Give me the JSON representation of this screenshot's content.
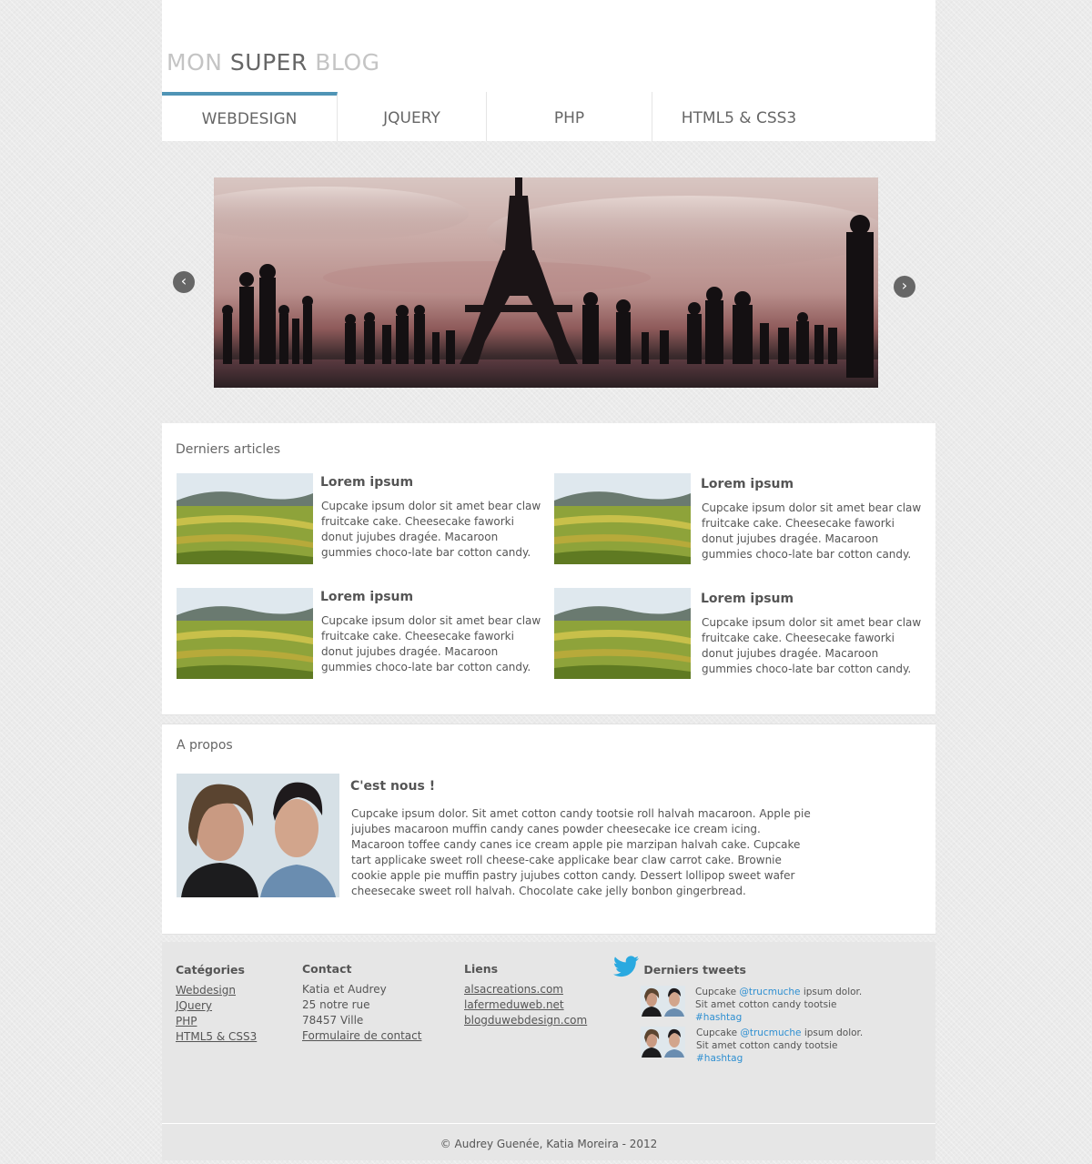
{
  "logo": {
    "part1": "MON",
    "part2": "SUPER",
    "part3": "BLOG"
  },
  "nav": [
    {
      "label": "WEBDESIGN"
    },
    {
      "label": "JQUERY"
    },
    {
      "label": "PHP"
    },
    {
      "label": "HTML5 & CSS3"
    }
  ],
  "slider": {
    "prev_label": "‹",
    "next_label": "›"
  },
  "articles": {
    "title": "Derniers articles",
    "items": [
      {
        "title": "Lorem ipsum",
        "text": "Cupcake ipsum dolor sit amet bear claw fruitcake cake. Cheesecake faworki donut jujubes dragée. Macaroon gummies choco-late bar cotton candy."
      },
      {
        "title": "Lorem ipsum",
        "text": "Cupcake ipsum dolor sit amet bear claw fruitcake cake. Cheesecake faworki donut jujubes dragée. Macaroon gummies choco-late bar cotton candy."
      },
      {
        "title": "Lorem ipsum",
        "text": "Cupcake ipsum dolor sit amet bear claw fruitcake cake. Cheesecake faworki donut jujubes dragée. Macaroon gummies choco-late bar cotton candy."
      },
      {
        "title": "Lorem ipsum",
        "text": "Cupcake ipsum dolor sit amet bear claw fruitcake cake. Cheesecake faworki donut jujubes dragée. Macaroon gummies choco-late bar cotton candy."
      }
    ]
  },
  "about": {
    "title": "A propos",
    "heading": "C'est nous !",
    "text": "Cupcake ipsum dolor. Sit amet cotton candy tootsie roll halvah macaroon. Apple pie jujubes macaroon muffin candy canes powder cheesecake ice cream icing. Macaroon toffee candy canes ice cream apple pie marzipan halvah cake. Cupcake tart applicake sweet roll cheese-cake applicake bear claw carrot cake. Brownie cookie apple pie muffin pastry jujubes cotton candy. Dessert lollipop sweet wafer cheesecake sweet roll halvah. Chocolate cake jelly bonbon gingerbread."
  },
  "footer": {
    "categories": {
      "title": "Catégories",
      "links": [
        "Webdesign",
        "JQuery",
        "PHP",
        "HTML5 & CSS3"
      ]
    },
    "contact": {
      "title": "Contact",
      "lines": [
        "Katia et Audrey",
        "25 notre rue",
        "78457 Ville"
      ],
      "form_link": "Formulaire de contact"
    },
    "links": {
      "title": "Liens",
      "links": [
        "alsacreations.com",
        "lafermeduweb.net",
        "blogduwebdesign.com"
      ]
    },
    "tweets": {
      "title": "Derniers tweets",
      "items": [
        {
          "before": "Cupcake ",
          "mention": "@trucmuche",
          "middle": " ipsum dolor. Sit amet cotton candy tootsie ",
          "hashtag": "#hashtag"
        },
        {
          "before": "Cupcake ",
          "mention": "@trucmuche",
          "middle": " ipsum dolor. Sit amet cotton candy tootsie ",
          "hashtag": "#hashtag"
        }
      ]
    }
  },
  "copyright": "© Audrey Guenée, Katia Moreira - 2012",
  "colors": {
    "accent": "#4f94b5",
    "link_blue": "#2e8fd1",
    "twitter": "#2aa9e0"
  },
  "icons": {
    "twitter": "twitter-bird-icon",
    "prev": "chevron-left-icon",
    "next": "chevron-right-icon"
  }
}
